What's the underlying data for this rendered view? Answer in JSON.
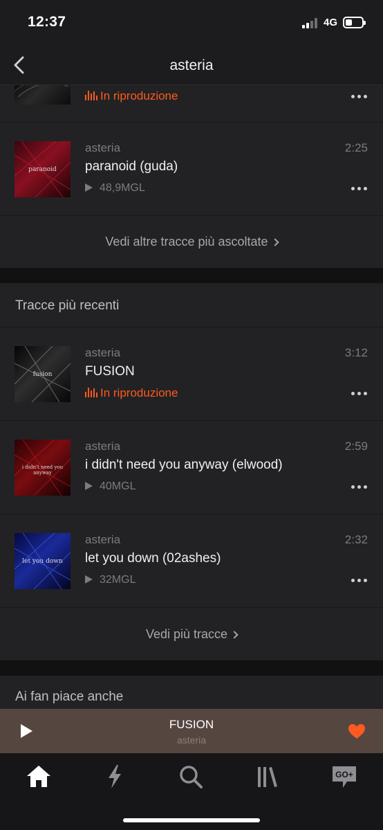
{
  "status_bar": {
    "time": "12:37",
    "network": "4G",
    "battery_level": 0.3
  },
  "header": {
    "title": "asteria",
    "back_icon": "chevron-left-icon"
  },
  "top_tracks_tail": {
    "partial_row": {
      "status": "In riproduzione"
    },
    "rows": [
      {
        "artist": "asteria",
        "title": "paranoid (guda)",
        "duration": "2:25",
        "plays": "48,9MGL",
        "art_label": "paranoid",
        "art_color": "#8a1020"
      }
    ],
    "see_more": "Vedi altre tracce più ascoltate"
  },
  "recent_tracks": {
    "title": "Tracce più recenti",
    "rows": [
      {
        "artist": "asteria",
        "title": "FUSION",
        "duration": "3:12",
        "status": "In riproduzione",
        "art_label": "fusion",
        "art_color": "#3a3a3a"
      },
      {
        "artist": "asteria",
        "title": "i didn't need you anyway (elwood)",
        "duration": "2:59",
        "plays": "40MGL",
        "art_label": "i didn't need you anyway",
        "art_color": "#7a0c10"
      },
      {
        "artist": "asteria",
        "title": "let you down (02ashes)",
        "duration": "2:32",
        "plays": "32MGL",
        "art_label": "let you down",
        "art_color": "#1a2a9a"
      }
    ],
    "see_more": "Vedi più tracce"
  },
  "fans_also_like": {
    "title": "Ai fan piace anche"
  },
  "mini_player": {
    "title": "FUSION",
    "artist": "asteria",
    "liked": true
  },
  "tab_bar": {
    "tabs": [
      {
        "icon": "home-icon",
        "active": true
      },
      {
        "icon": "stream-bolt-icon",
        "active": false
      },
      {
        "icon": "search-icon",
        "active": false
      },
      {
        "icon": "library-icon",
        "active": false
      },
      {
        "icon": "go-plus-icon",
        "label": "GO+",
        "active": false
      }
    ]
  },
  "colors": {
    "accent": "#ff5a1f",
    "background": "#111112",
    "panel": "#222224",
    "mini_player": "#554640"
  }
}
